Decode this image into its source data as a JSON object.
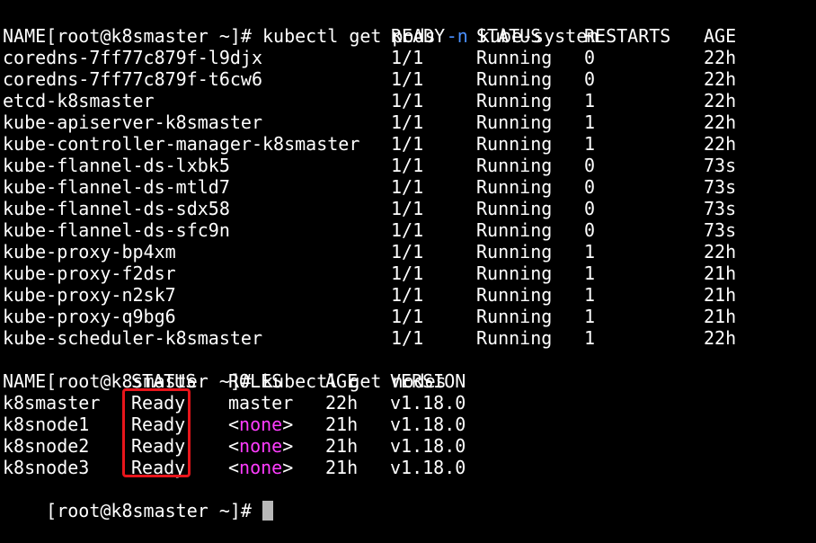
{
  "commands": {
    "pods": {
      "prompt": "[root@k8smaster ~]#",
      "cmd": "kubectl get pods",
      "flag": "-n",
      "arg": "kube-system"
    },
    "nodes": {
      "prompt": "[root@k8smaster ~]#",
      "cmd": "kubectl get nodes"
    },
    "final": {
      "prompt": "[root@k8smaster ~]#"
    }
  },
  "pods_table": {
    "headers": [
      "NAME",
      "READY",
      "STATUS",
      "RESTARTS",
      "AGE"
    ],
    "rows": [
      [
        "coredns-7ff77c879f-l9djx",
        "1/1",
        "Running",
        "0",
        "22h"
      ],
      [
        "coredns-7ff77c879f-t6cw6",
        "1/1",
        "Running",
        "0",
        "22h"
      ],
      [
        "etcd-k8smaster",
        "1/1",
        "Running",
        "1",
        "22h"
      ],
      [
        "kube-apiserver-k8smaster",
        "1/1",
        "Running",
        "1",
        "22h"
      ],
      [
        "kube-controller-manager-k8smaster",
        "1/1",
        "Running",
        "1",
        "22h"
      ],
      [
        "kube-flannel-ds-lxbk5",
        "1/1",
        "Running",
        "0",
        "73s"
      ],
      [
        "kube-flannel-ds-mtld7",
        "1/1",
        "Running",
        "0",
        "73s"
      ],
      [
        "kube-flannel-ds-sdx58",
        "1/1",
        "Running",
        "0",
        "73s"
      ],
      [
        "kube-flannel-ds-sfc9n",
        "1/1",
        "Running",
        "0",
        "73s"
      ],
      [
        "kube-proxy-bp4xm",
        "1/1",
        "Running",
        "1",
        "22h"
      ],
      [
        "kube-proxy-f2dsr",
        "1/1",
        "Running",
        "1",
        "21h"
      ],
      [
        "kube-proxy-n2sk7",
        "1/1",
        "Running",
        "1",
        "21h"
      ],
      [
        "kube-proxy-q9bg6",
        "1/1",
        "Running",
        "1",
        "21h"
      ],
      [
        "kube-scheduler-k8smaster",
        "1/1",
        "Running",
        "1",
        "22h"
      ]
    ]
  },
  "nodes_table": {
    "headers": [
      "NAME",
      "STATUS",
      "ROLES",
      "AGE",
      "VERSION"
    ],
    "rows": [
      [
        "k8smaster",
        "Ready",
        "master",
        "22h",
        "v1.18.0"
      ],
      [
        "k8snode1",
        "Ready",
        "<none>",
        "21h",
        "v1.18.0"
      ],
      [
        "k8snode2",
        "Ready",
        "<none>",
        "21h",
        "v1.18.0"
      ],
      [
        "k8snode3",
        "Ready",
        "<none>",
        "21h",
        "v1.18.0"
      ]
    ]
  },
  "colors": {
    "background": "#000000",
    "text": "#ffffff",
    "flag": "#4a90ff",
    "none_role": "#ff3cff",
    "highlight": "#e8151b",
    "cursor": "#b8b8b8"
  }
}
